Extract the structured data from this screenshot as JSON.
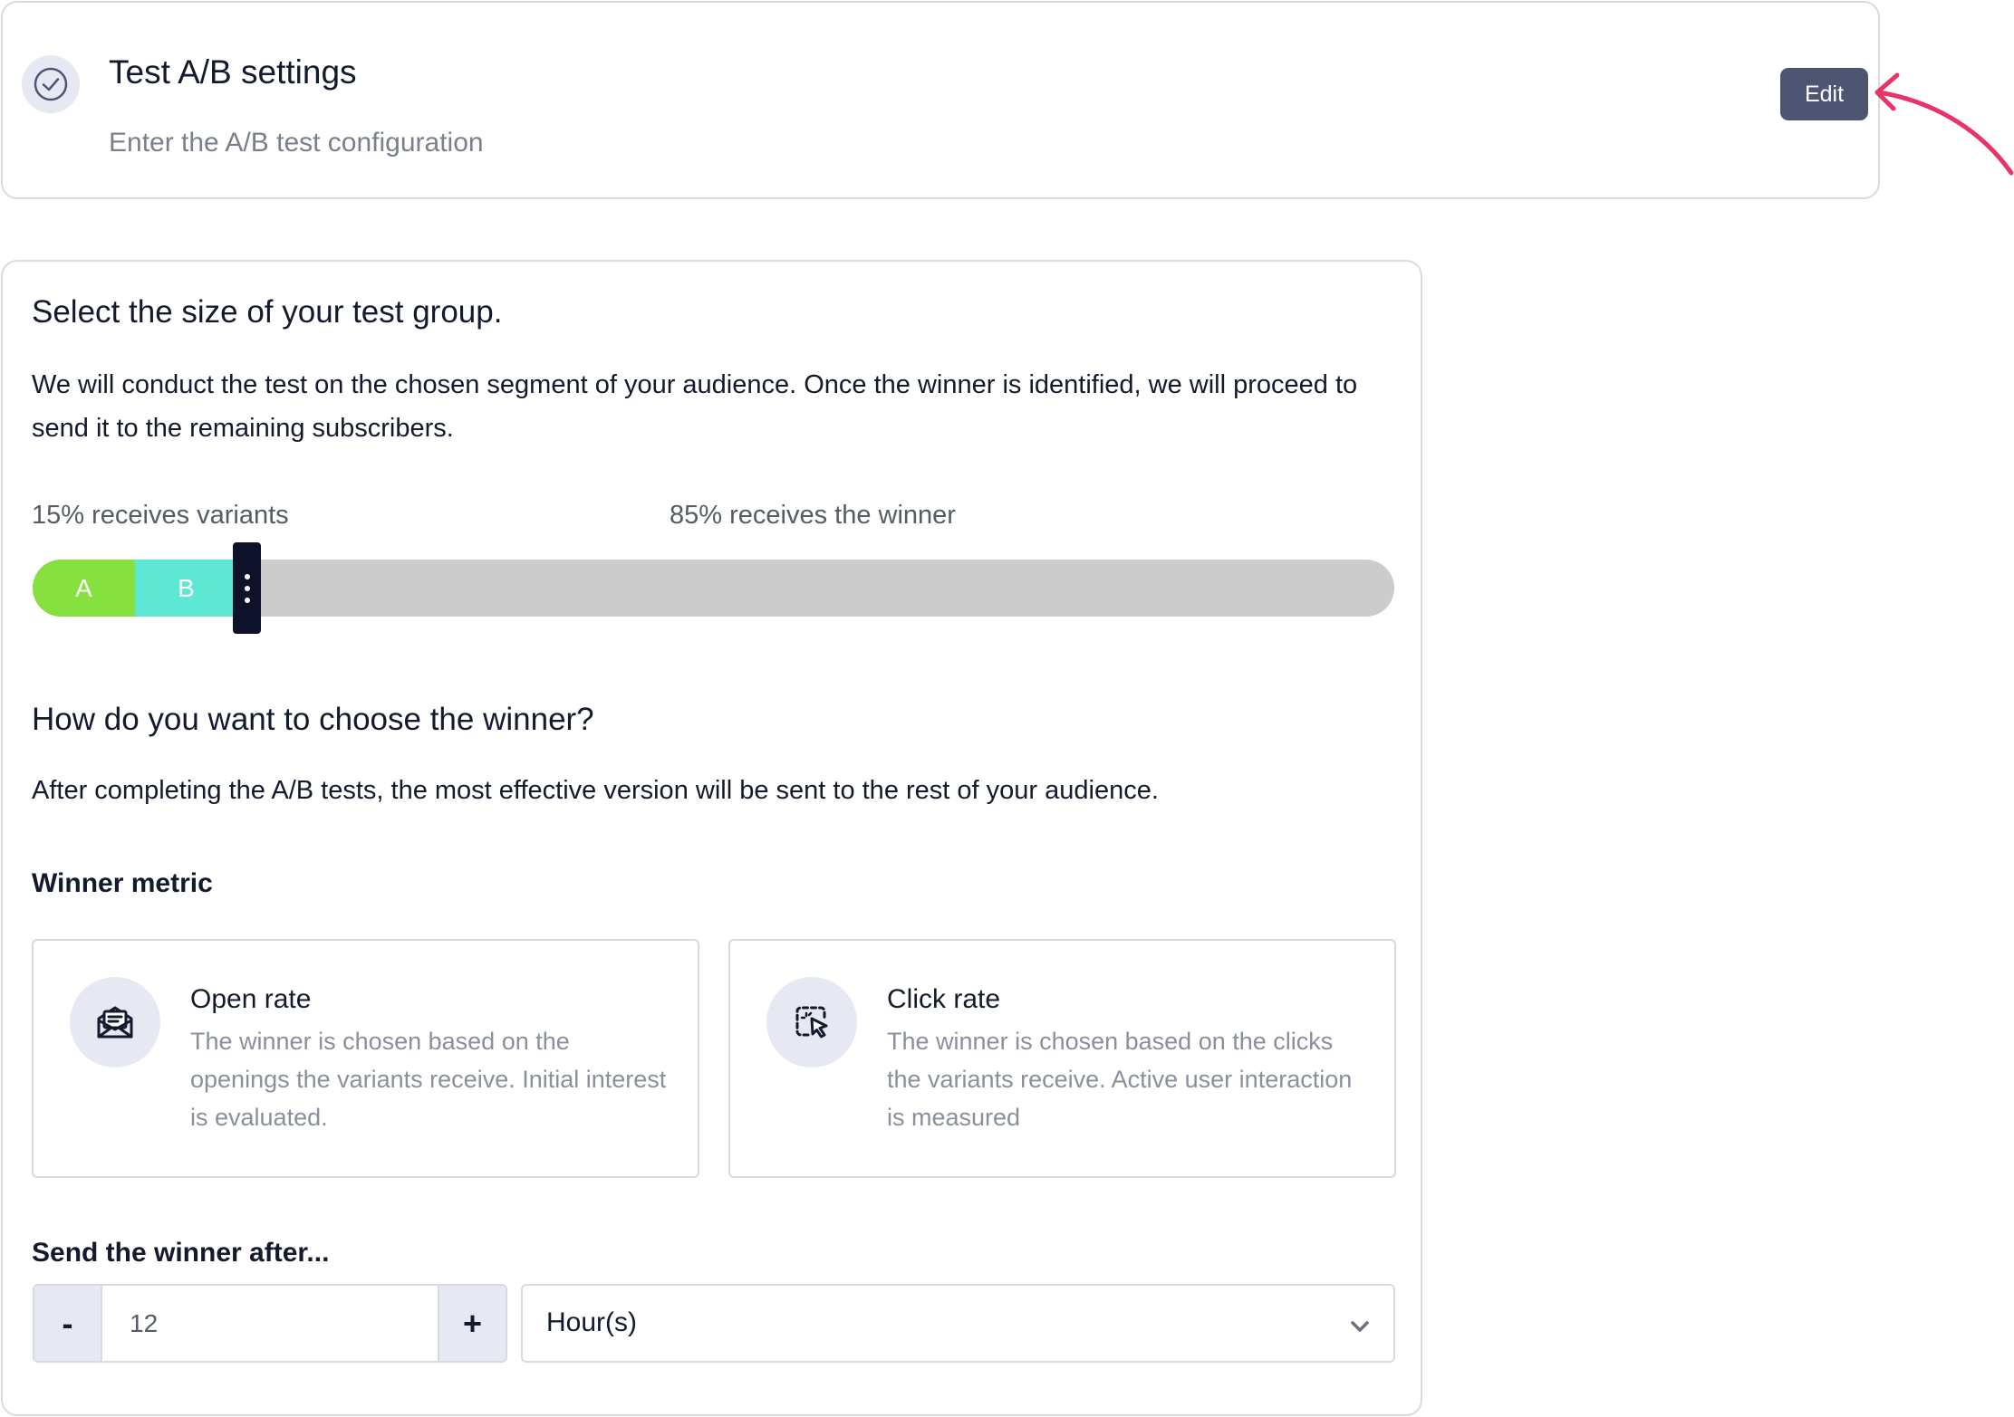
{
  "header": {
    "title": "Test A/B settings",
    "subtitle": "Enter the A/B test configuration",
    "edit_label": "Edit",
    "status_icon": "check-circle-icon",
    "annotation_color": "#e8336a"
  },
  "test_group": {
    "title": "Select the size of your test group.",
    "description": "We will conduct the test on the chosen segment of your audience. Once the winner is identified, we will proceed to send it to the remaining subscribers.",
    "variants_label": "15% receives variants",
    "winner_label": "85% receives the winner",
    "variants_percent": 15,
    "segments": [
      {
        "label": "A",
        "color": "#86e03f"
      },
      {
        "label": "B",
        "color": "#5ce8d4"
      }
    ]
  },
  "winner": {
    "title": "How do you want to choose the winner?",
    "description": "After completing the A/B tests, the most effective version will be sent to the rest of your audience.",
    "metric_label": "Winner metric",
    "metrics": [
      {
        "title": "Open rate",
        "description": "The winner is chosen based on the openings the variants receive. Initial interest is evaluated.",
        "icon": "envelope-open-icon"
      },
      {
        "title": "Click rate",
        "description": "The winner is chosen based on the clicks the variants receive. Active user interaction is measured",
        "icon": "cursor-click-icon"
      }
    ]
  },
  "send_after": {
    "label": "Send the winner after...",
    "minus_label": "-",
    "plus_label": "+",
    "value": "12",
    "unit": "Hour(s)"
  }
}
